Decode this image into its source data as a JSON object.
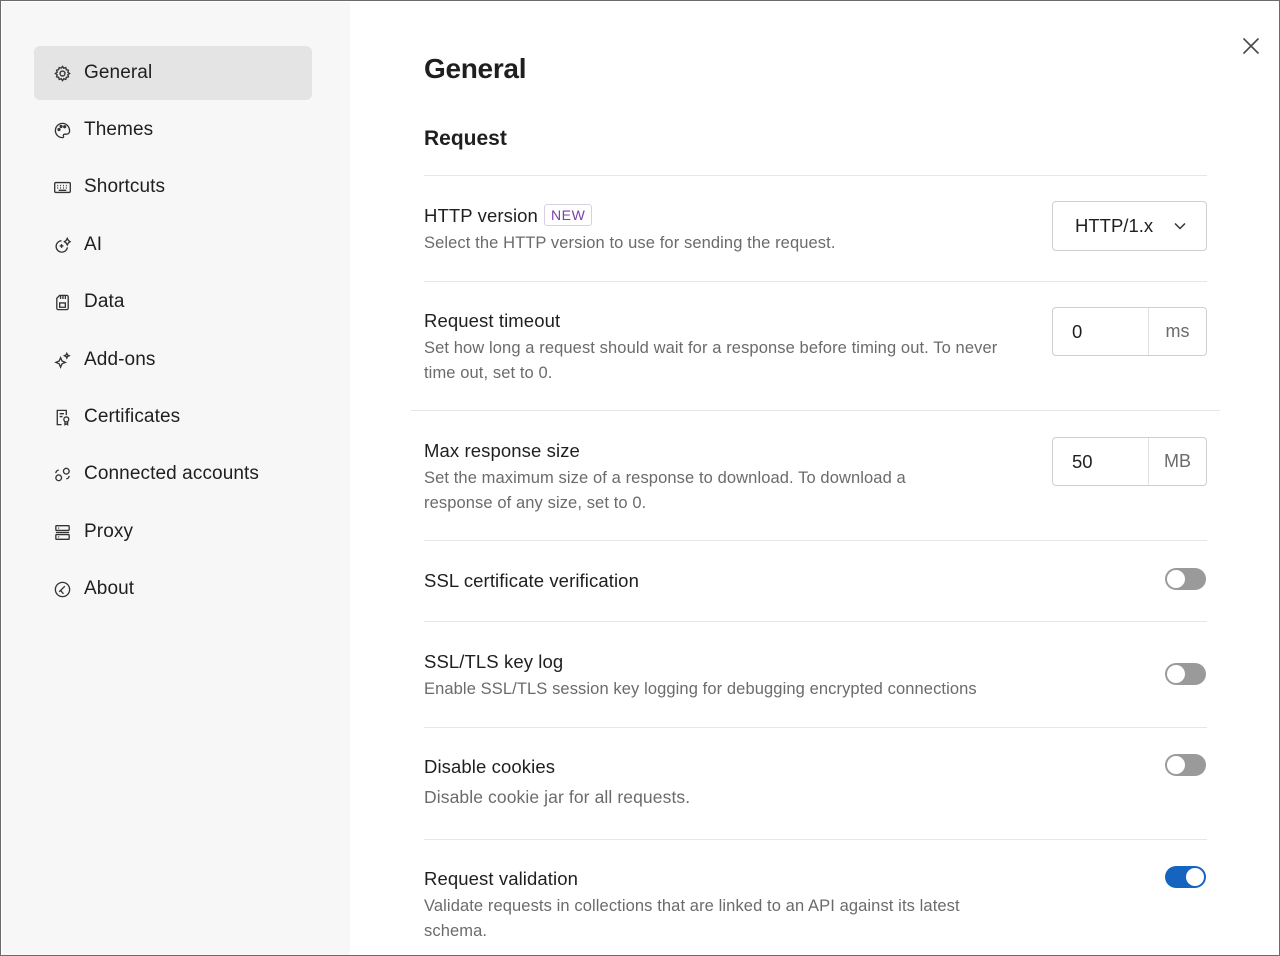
{
  "sidebar": {
    "items": [
      {
        "label": "General",
        "icon": "gear-icon",
        "active": true
      },
      {
        "label": "Themes",
        "icon": "palette-icon",
        "active": false
      },
      {
        "label": "Shortcuts",
        "icon": "keyboard-icon",
        "active": false
      },
      {
        "label": "AI",
        "icon": "ai-sparkle-icon",
        "active": false
      },
      {
        "label": "Data",
        "icon": "save-disk-icon",
        "active": false
      },
      {
        "label": "Add-ons",
        "icon": "sparkle-icon",
        "active": false
      },
      {
        "label": "Certificates",
        "icon": "certificate-icon",
        "active": false
      },
      {
        "label": "Connected accounts",
        "icon": "connected-accounts-icon",
        "active": false
      },
      {
        "label": "Proxy",
        "icon": "server-icon",
        "active": false
      },
      {
        "label": "About",
        "icon": "about-logo-icon",
        "active": false
      }
    ]
  },
  "main": {
    "title": "General",
    "section": "Request",
    "settings": {
      "http_version": {
        "title": "HTTP version",
        "badge": "NEW",
        "description": "Select the HTTP version to use for sending the request.",
        "value": "HTTP/1.x"
      },
      "timeout": {
        "title": "Request timeout",
        "description": "Set how long a request should wait for a response before timing out. To never time out, set to 0.",
        "value": "0",
        "unit": "ms"
      },
      "max_response": {
        "title": "Max response size",
        "description": "Set the maximum size of a response to download. To download a response of any size, set to 0.",
        "value": "50",
        "unit": "MB"
      },
      "ssl_verification": {
        "title": "SSL certificate verification",
        "enabled": false
      },
      "ssl_key_log": {
        "title": "SSL/TLS key log",
        "description": "Enable SSL/TLS session key logging for debugging encrypted connections",
        "enabled": false
      },
      "disable_cookies": {
        "title": "Disable cookies",
        "description": "Disable cookie jar for all requests.",
        "enabled": false
      },
      "request_validation": {
        "title": "Request validation",
        "description": "Validate requests in collections that are linked to an API against its latest schema.",
        "enabled": true
      }
    }
  },
  "colors": {
    "accent": "#1565c0",
    "badge": "#7a3fb0",
    "sidebar_bg": "#f7f7f7",
    "active_bg": "#e4e4e4"
  }
}
